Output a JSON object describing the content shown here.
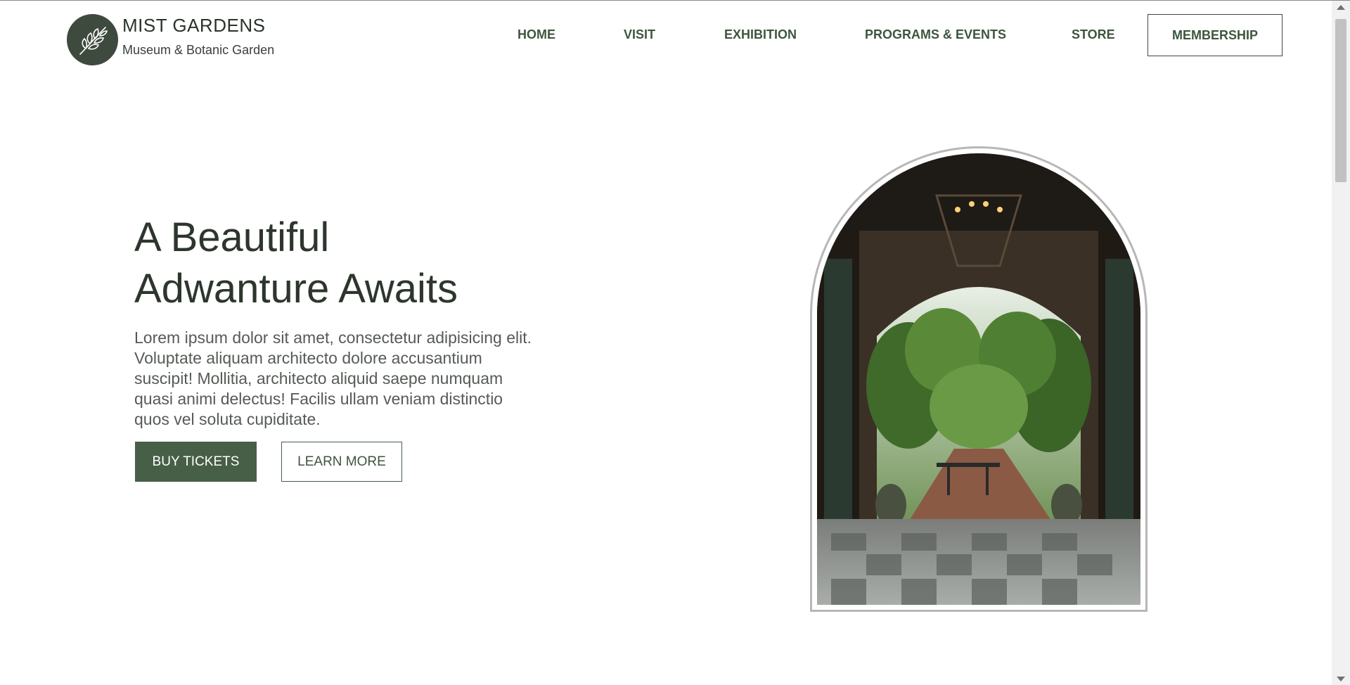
{
  "brand": {
    "name": "MIST GARDENS",
    "subtitle": "Museum & Botanic Garden",
    "logo_icon": "leaf-branch-icon",
    "color": "#3e4a3e"
  },
  "nav": {
    "items": [
      {
        "label": "HOME"
      },
      {
        "label": "VISIT"
      },
      {
        "label": "EXHIBITION"
      },
      {
        "label": "PROGRAMS & EVENTS"
      },
      {
        "label": "STORE"
      }
    ],
    "membership_label": "MEMBERSHIP"
  },
  "hero": {
    "title_line1": "A Beautiful",
    "title_line2": "Adwanture Awaits",
    "text": "Lorem ipsum dolor sit amet, consectetur adipisicing elit. Voluptate aliquam architecto dolore accusantium suscipit! Mollitia, architecto aliquid saepe numquam quasi animi delectus! Facilis ullam veniam distinctio quos vel soluta cupiditate.",
    "buy_label": "BUY TICKETS",
    "learn_label": "LEARN MORE",
    "accent": "#475e47"
  }
}
